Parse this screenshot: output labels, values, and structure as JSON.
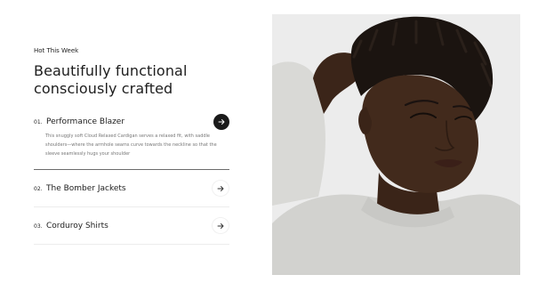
{
  "section": {
    "eyebrow": "Hot This Week",
    "headline": "Beautifully functional consciously crafted"
  },
  "accordion": {
    "items": [
      {
        "number": "01.",
        "title": "Performance Blazer",
        "description": "This snuggly soft Cloud Relaxed Cardigan serves a relaxed fit, with saddle shoulders—where the armhole seams curve towards the neckline so that the sleeve seamlessly hugs your shoulder",
        "expanded": true,
        "icon": "arrow-right-icon"
      },
      {
        "number": "02.",
        "title": "The Bomber Jackets",
        "expanded": false,
        "icon": "arrow-right-icon"
      },
      {
        "number": "03.",
        "title": "Corduroy Shirts",
        "expanded": false,
        "icon": "arrow-right-icon"
      }
    ]
  },
  "colors": {
    "text": "#1d1d1d",
    "muted_text": "#777777",
    "active_button": "#1a1a1a",
    "divider": "#ececec",
    "active_divider": "#6b6b6b",
    "photo_background": "#ececec"
  }
}
